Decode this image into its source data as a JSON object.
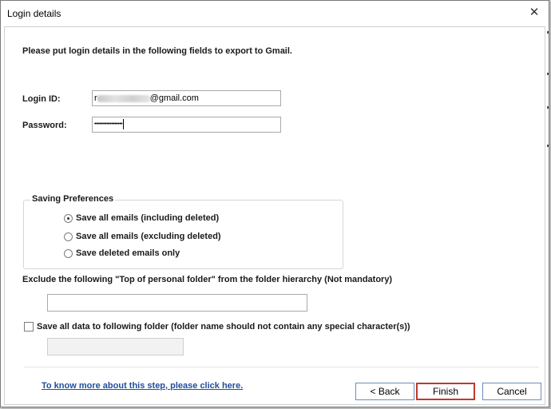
{
  "window": {
    "title": "Login details",
    "close_glyph": "✕"
  },
  "instruction": "Please put login details in the following fields to export to Gmail.",
  "login": {
    "id_label": "Login ID:",
    "id_prefix": "r",
    "id_suffix": "@gmail.com",
    "password_label": "Password:",
    "password_mask": "••••••••••••••••••"
  },
  "saving": {
    "group_title": "Saving Preferences",
    "options": [
      {
        "label": "Save all emails (including deleted)",
        "selected": true
      },
      {
        "label": "Save all emails (excluding deleted)",
        "selected": false
      },
      {
        "label": "Save deleted emails only",
        "selected": false
      }
    ]
  },
  "exclude": {
    "label": "Exclude the following \"Top of personal folder\" from the folder hierarchy  (Not mandatory)",
    "value": ""
  },
  "save_folder": {
    "label": "Save all data to following folder (folder name should not contain any special character(s))",
    "checked": false,
    "value": ""
  },
  "footer": {
    "link": "To know more about this step, please click here.",
    "back": "< Back",
    "finish": "Finish",
    "cancel": "Cancel"
  },
  "colors": {
    "link": "#1f4e9c",
    "finish_border": "#c0392b",
    "button_border": "#6b8fb8"
  }
}
